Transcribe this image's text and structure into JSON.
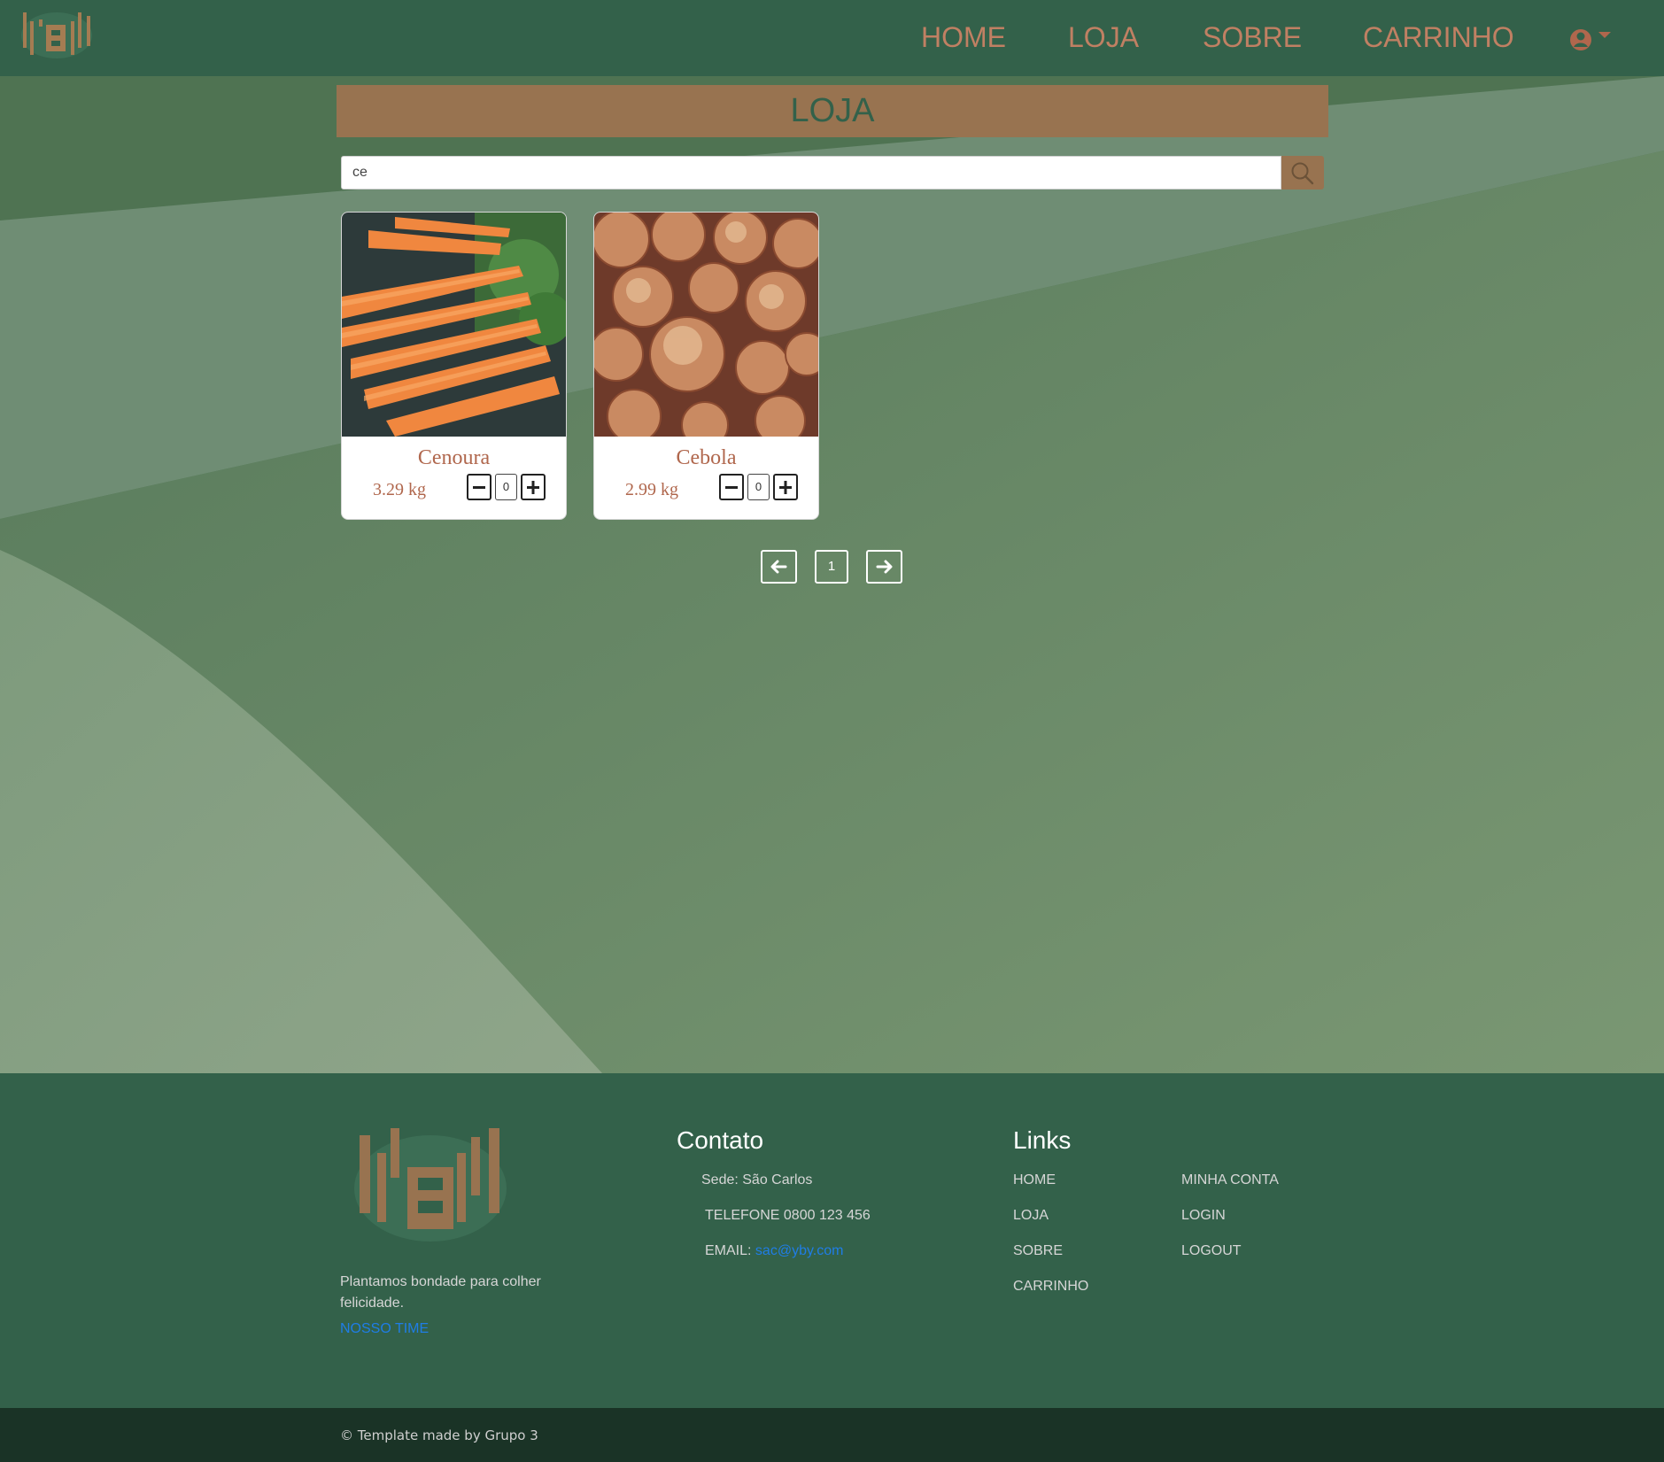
{
  "colors": {
    "header_green": "#33614a",
    "accent_brown": "#987350",
    "nav_text": "#c08063",
    "price_text": "#b0674d",
    "link_blue": "#1f7de6",
    "bottom_bar": "#1a3326"
  },
  "nav": {
    "logo_icon": "yby-logo-icon",
    "items": [
      {
        "label": "HOME"
      },
      {
        "label": "LOJA"
      },
      {
        "label": "SOBRE"
      },
      {
        "label": "CARRINHO"
      }
    ],
    "user_icon": "user-circle-icon",
    "user_caret_icon": "caret-down-icon"
  },
  "main": {
    "title": "LOJA",
    "search": {
      "value": "ce",
      "icon": "search-icon"
    },
    "products": [
      {
        "name": "Cenoura",
        "price": "3.29 kg",
        "quantity": "0",
        "image_icon": "carrots-photo"
      },
      {
        "name": "Cebola",
        "price": "2.99 kg",
        "quantity": "0",
        "image_icon": "onions-photo"
      }
    ],
    "pagination": {
      "prev_icon": "arrow-left-icon",
      "page": "1",
      "next_icon": "arrow-right-icon"
    }
  },
  "footer": {
    "tagline": "Plantamos bondade para colher felicidade.",
    "team_link": "NOSSO TIME",
    "contact": {
      "heading": "Contato",
      "sede": "Sede: São Carlos",
      "phone": "TELEFONE 0800 123 456",
      "email_label": "EMAIL:",
      "email": "sac@yby.com"
    },
    "links": {
      "heading": "Links",
      "col1": [
        "HOME",
        "LOJA",
        "SOBRE",
        "CARRINHO"
      ],
      "col2": [
        "MINHA CONTA",
        "LOGIN",
        "LOGOUT"
      ]
    },
    "copyright": "© Template made by Grupo 3"
  }
}
